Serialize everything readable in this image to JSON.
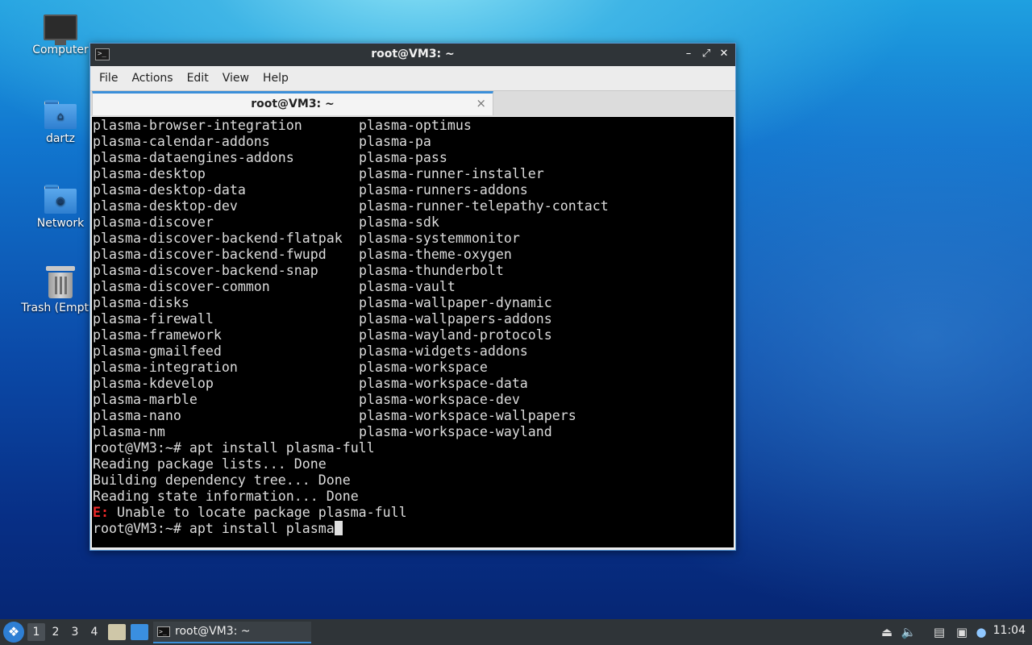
{
  "desktop": {
    "icons": [
      {
        "label": "Computer",
        "icon": "computer-icon"
      },
      {
        "label": "dartz",
        "icon": "home-folder-icon"
      },
      {
        "label": "Network",
        "icon": "network-folder-icon"
      },
      {
        "label": "Trash (Empty)",
        "icon": "trash-icon"
      }
    ]
  },
  "window": {
    "title": "root@VM3: ~",
    "controls": {
      "minimize": "–",
      "maximize": "⤢",
      "close": "✕"
    },
    "menu": [
      "File",
      "Actions",
      "Edit",
      "View",
      "Help"
    ],
    "tab": {
      "label": "root@VM3: ~",
      "close": "×"
    }
  },
  "terminal": {
    "columns": [
      [
        "plasma-browser-integration",
        "plasma-optimus"
      ],
      [
        "plasma-calendar-addons",
        "plasma-pa"
      ],
      [
        "plasma-dataengines-addons",
        "plasma-pass"
      ],
      [
        "plasma-desktop",
        "plasma-runner-installer"
      ],
      [
        "plasma-desktop-data",
        "plasma-runners-addons"
      ],
      [
        "plasma-desktop-dev",
        "plasma-runner-telepathy-contact"
      ],
      [
        "plasma-discover",
        "plasma-sdk"
      ],
      [
        "plasma-discover-backend-flatpak",
        "plasma-systemmonitor"
      ],
      [
        "plasma-discover-backend-fwupd",
        "plasma-theme-oxygen"
      ],
      [
        "plasma-discover-backend-snap",
        "plasma-thunderbolt"
      ],
      [
        "plasma-discover-common",
        "plasma-vault"
      ],
      [
        "plasma-disks",
        "plasma-wallpaper-dynamic"
      ],
      [
        "plasma-firewall",
        "plasma-wallpapers-addons"
      ],
      [
        "plasma-framework",
        "plasma-wayland-protocols"
      ],
      [
        "plasma-gmailfeed",
        "plasma-widgets-addons"
      ],
      [
        "plasma-integration",
        "plasma-workspace"
      ],
      [
        "plasma-kdevelop",
        "plasma-workspace-data"
      ],
      [
        "plasma-marble",
        "plasma-workspace-dev"
      ],
      [
        "plasma-nano",
        "plasma-workspace-wallpapers"
      ],
      [
        "plasma-nm",
        "plasma-workspace-wayland"
      ]
    ],
    "output": [
      "root@VM3:~# apt install plasma-full",
      "Reading package lists... Done",
      "Building dependency tree... Done",
      "Reading state information... Done"
    ],
    "error": {
      "prefix": "E:",
      "message": " Unable to locate package plasma-full"
    },
    "prompt": "root@VM3:~# apt install plasma"
  },
  "taskbar": {
    "workspaces": [
      "1",
      "2",
      "3",
      "4"
    ],
    "active_workspace": "1",
    "task_label": "root@VM3: ~",
    "clock": "11:04"
  },
  "colors": {
    "accent": "#3b8fd9",
    "error": "#ef2929",
    "terminal_bg": "#000000",
    "terminal_fg": "#dcdcdc"
  }
}
